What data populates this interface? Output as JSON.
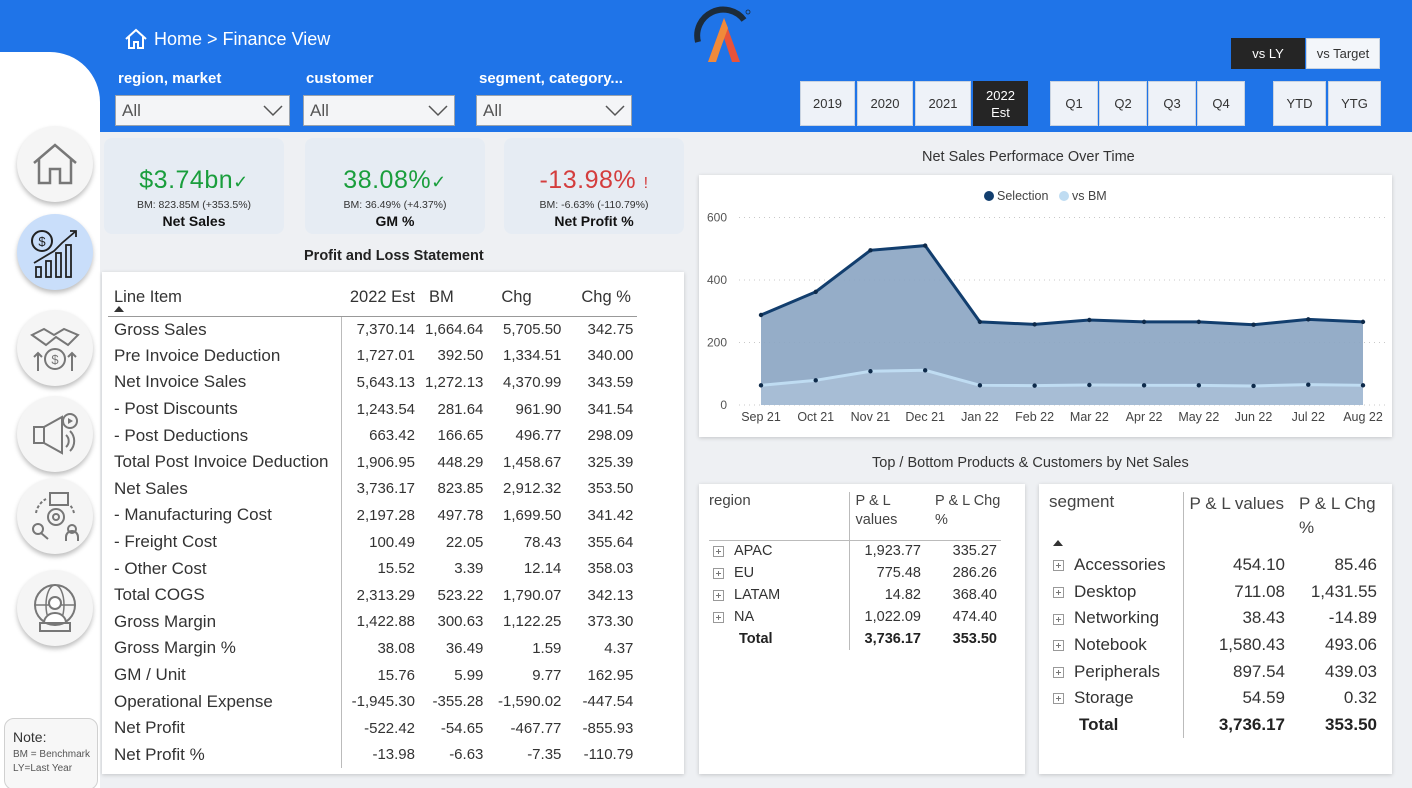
{
  "breadcrumb": "Home > Finance View",
  "filters": [
    {
      "label": "region, market",
      "value": "All"
    },
    {
      "label": "customer",
      "value": "All"
    },
    {
      "label": "segment, category...",
      "value": "All"
    }
  ],
  "compare_buttons": {
    "vs_ly": "vs LY",
    "vs_target": "vs Target",
    "active": "vs LY"
  },
  "year_buttons": [
    "2019",
    "2020",
    "2021",
    "2022 Est"
  ],
  "active_year": "2022 Est",
  "quarter_buttons": [
    "Q1",
    "Q2",
    "Q3",
    "Q4"
  ],
  "ytd_buttons": [
    "YTD",
    "YTG"
  ],
  "nav_icons": [
    "home-icon",
    "finance-icon",
    "sales-icon",
    "marketing-icon",
    "supply-chain-icon",
    "executive-icon"
  ],
  "note": {
    "title": "Note:",
    "lines": [
      "BM = Benchmark",
      "LY=Last Year"
    ]
  },
  "kpis": [
    {
      "value": "$3.74bn",
      "indicator": "✓",
      "bm": "BM: 823.85M (+353.5%)",
      "name": "Net Sales",
      "color": "#1a9e3c"
    },
    {
      "value": "38.08%",
      "indicator": "✓",
      "bm": "BM: 36.49% (+4.37%)",
      "name": "GM %",
      "color": "#1a9e3c"
    },
    {
      "value": "-13.98%",
      "indicator": "!",
      "bm": "BM: -6.63% (-110.79%)",
      "name": "Net Profit %",
      "color": "#d43d3d"
    }
  ],
  "pl": {
    "title": "Profit and Loss Statement",
    "columns": [
      "Line Item",
      "2022 Est",
      "BM",
      "Chg",
      "Chg %"
    ],
    "rows": [
      [
        "Gross Sales",
        "7,370.14",
        "1,664.64",
        "5,705.50",
        "342.75"
      ],
      [
        "Pre Invoice Deduction",
        "1,727.01",
        "392.50",
        "1,334.51",
        "340.00"
      ],
      [
        "Net Invoice Sales",
        "5,643.13",
        "1,272.13",
        "4,370.99",
        "343.59"
      ],
      [
        " - Post Discounts",
        "1,243.54",
        "281.64",
        "961.90",
        "341.54"
      ],
      [
        " - Post Deductions",
        "663.42",
        "166.65",
        "496.77",
        "298.09"
      ],
      [
        "Total Post Invoice Deduction",
        "1,906.95",
        "448.29",
        "1,458.67",
        "325.39"
      ],
      [
        "Net Sales",
        "3,736.17",
        "823.85",
        "2,912.32",
        "353.50"
      ],
      [
        " - Manufacturing Cost",
        "2,197.28",
        "497.78",
        "1,699.50",
        "341.42"
      ],
      [
        " - Freight Cost",
        "100.49",
        "22.05",
        "78.43",
        "355.64"
      ],
      [
        " - Other Cost",
        "15.52",
        "3.39",
        "12.14",
        "358.03"
      ],
      [
        "Total COGS",
        "2,313.29",
        "523.22",
        "1,790.07",
        "342.13"
      ],
      [
        "Gross Margin",
        "1,422.88",
        "300.63",
        "1,122.25",
        "373.30"
      ],
      [
        "Gross Margin %",
        "38.08",
        "36.49",
        "1.59",
        "4.37"
      ],
      [
        "GM / Unit",
        "15.76",
        "5.99",
        "9.77",
        "162.95"
      ],
      [
        "Operational Expense",
        "-1,945.30",
        "-355.28",
        "-1,590.02",
        "-447.54"
      ],
      [
        "Net Profit",
        "-522.42",
        "-54.65",
        "-467.77",
        "-855.93"
      ],
      [
        "Net Profit %",
        "-13.98",
        "-6.63",
        "-7.35",
        "-110.79"
      ]
    ]
  },
  "chart_data": {
    "type": "area",
    "title": "Net Sales Performace Over Time",
    "x": [
      "Sep 21",
      "Oct 21",
      "Nov 21",
      "Dec 21",
      "Jan 22",
      "Feb 22",
      "Mar 22",
      "Apr 22",
      "May 22",
      "Jun 22",
      "Jul 22",
      "Aug 22"
    ],
    "series": [
      {
        "name": "Selection",
        "values": [
          288,
          362,
          495,
          510,
          266,
          258,
          272,
          266,
          266,
          257,
          274,
          266
        ],
        "color": "#123e6e"
      },
      {
        "name": "vs BM",
        "values": [
          63,
          79,
          108,
          111,
          63,
          62,
          64,
          63,
          63,
          61,
          65,
          63
        ],
        "color": "#bfdcf2"
      }
    ],
    "yticks": [
      0,
      200,
      400,
      600
    ],
    "ylim": [
      0,
      640
    ],
    "legend_position": "top",
    "grid": true
  },
  "tb_title": "Top / Bottom Products & Customers by Net Sales",
  "region_table": {
    "headers": [
      "region",
      "P & L values",
      "P & L Chg %"
    ],
    "rows": [
      [
        "APAC",
        "1,923.77",
        "335.27"
      ],
      [
        "EU",
        "775.48",
        "286.26"
      ],
      [
        "LATAM",
        "14.82",
        "368.40"
      ],
      [
        "NA",
        "1,022.09",
        "474.40"
      ]
    ],
    "total": [
      "Total",
      "3,736.17",
      "353.50"
    ]
  },
  "segment_table": {
    "headers": [
      "segment",
      "P & L values",
      "P & L Chg %"
    ],
    "rows": [
      [
        "Accessories",
        "454.10",
        "85.46"
      ],
      [
        "Desktop",
        "711.08",
        "1,431.55"
      ],
      [
        "Networking",
        "38.43",
        "-14.89"
      ],
      [
        "Notebook",
        "1,580.43",
        "493.06"
      ],
      [
        "Peripherals",
        "897.54",
        "439.03"
      ],
      [
        "Storage",
        "54.59",
        "0.32"
      ]
    ],
    "total": [
      "Total",
      "3,736.17",
      "353.50"
    ]
  }
}
